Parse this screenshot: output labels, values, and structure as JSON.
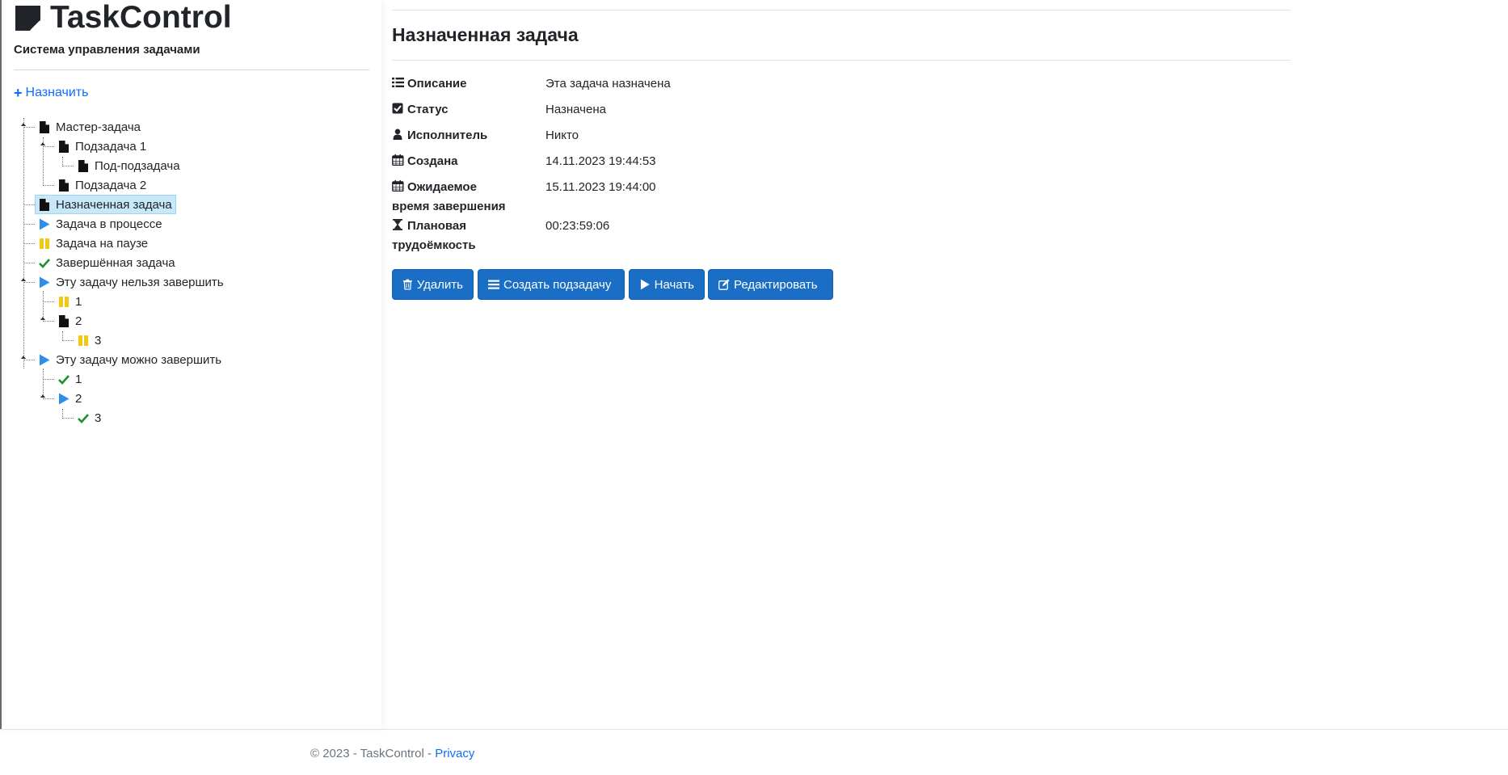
{
  "app": {
    "title": "TaskControl",
    "subtitle": "Система управления задачами",
    "assign_label": "Назначить"
  },
  "tree": {
    "nodes": [
      {
        "label": "Мастер-задача",
        "icon": "file-icon",
        "status": "new"
      },
      {
        "label": "Подзадача 1",
        "icon": "file-icon",
        "status": "new"
      },
      {
        "label": "Под-подзадача",
        "icon": "file-icon",
        "status": "new"
      },
      {
        "label": "Подзадача 2",
        "icon": "file-icon",
        "status": "new"
      },
      {
        "label": "Назначенная задача",
        "icon": "file-icon",
        "status": "assigned",
        "selected": true
      },
      {
        "label": "Задача в процессе",
        "icon": "play-icon",
        "status": "in-progress"
      },
      {
        "label": "Задача на паузе",
        "icon": "pause-icon",
        "status": "paused"
      },
      {
        "label": "Завершённая задача",
        "icon": "check-icon",
        "status": "done"
      },
      {
        "label": "Эту задачу нельзя завершить",
        "icon": "play-icon",
        "status": "in-progress"
      },
      {
        "label": "1",
        "icon": "pause-icon",
        "status": "paused"
      },
      {
        "label": "2",
        "icon": "file-icon",
        "status": "new"
      },
      {
        "label": "3",
        "icon": "pause-icon",
        "status": "paused"
      },
      {
        "label": "Эту задачу можно завершить",
        "icon": "play-icon",
        "status": "in-progress"
      },
      {
        "label": "1",
        "icon": "check-icon",
        "status": "done"
      },
      {
        "label": "2",
        "icon": "play-icon",
        "status": "in-progress"
      },
      {
        "label": "3",
        "icon": "check-icon",
        "status": "done"
      }
    ]
  },
  "task": {
    "title": "Назначенная задача",
    "fields": {
      "description": {
        "label": "Описание",
        "icon": "list-icon",
        "value": "Эта задача назначена"
      },
      "status": {
        "label": "Статус",
        "icon": "checkbox-icon",
        "value": "Назначена"
      },
      "assignee": {
        "label": "Исполнитель",
        "icon": "user-icon",
        "value": "Никто"
      },
      "created": {
        "label": "Создана",
        "icon": "calendar-icon",
        "value": "14.11.2023 19:44:53"
      },
      "expected_end": {
        "label": "Ожидаемое время завершения",
        "label_line1": "Ожидаемое",
        "label_line2": "время завершения",
        "icon": "calendar-icon",
        "value": "15.11.2023 19:44:00"
      },
      "planned_effort": {
        "label": "Плановая трудоёмкость",
        "label_line1": "Плановая",
        "label_line2": "трудоёмкость",
        "icon": "hourglass-icon",
        "value": "00:23:59:06"
      }
    },
    "buttons": {
      "delete": "Удалить",
      "create_subtask": "Создать подзадачу",
      "start": "Начать",
      "edit": "Редактировать"
    }
  },
  "footer": {
    "copyright": "© 2023 - TaskControl - ",
    "privacy": "Privacy"
  },
  "colors": {
    "primary": "#1a6ec5",
    "link": "#0d6efd",
    "play": "#2f8fe8",
    "pause": "#f2c811",
    "check": "#16922b",
    "selected_bg": "#c6e8f9"
  }
}
